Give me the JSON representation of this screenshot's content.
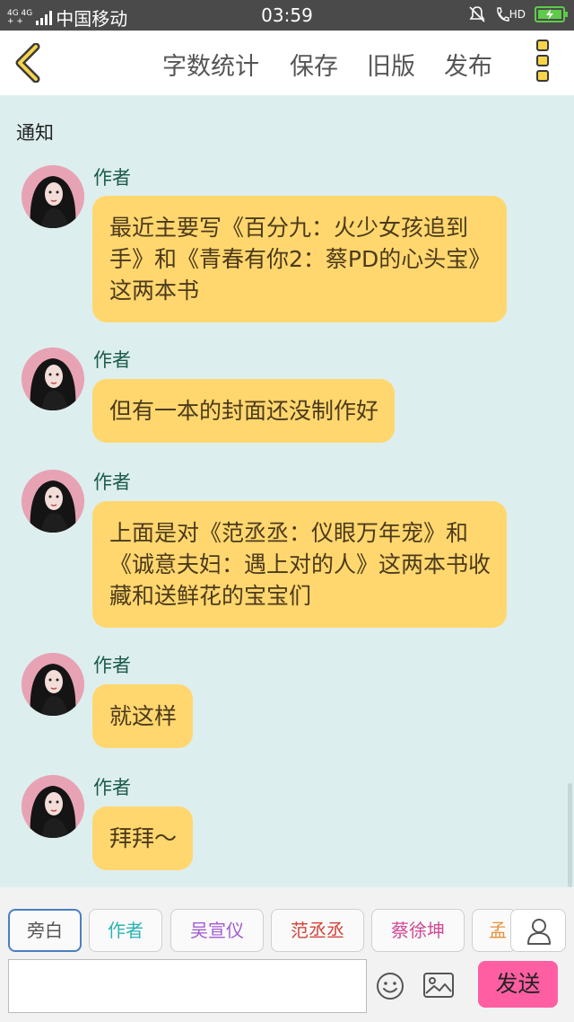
{
  "status": {
    "net_top": "4G 4G",
    "net_bottom": "+ +",
    "carrier": "中国移动",
    "time": "03:59",
    "hd": "HD"
  },
  "header": {
    "menu": [
      "字数统计",
      "保存",
      "旧版",
      "发布"
    ]
  },
  "notice": "通知",
  "messages": [
    {
      "author": "作者",
      "text": "最近主要写《百分九：火少女孩追到手》和《青春有你2：蔡PD的心头宝》这两本书"
    },
    {
      "author": "作者",
      "text": "但有一本的封面还没制作好"
    },
    {
      "author": "作者",
      "text": "上面是对《范丞丞：仪眼万年宠》和《诚意夫妇：遇上对的人》这两本书收藏和送鲜花的宝宝们"
    },
    {
      "author": "作者",
      "text": "就这样"
    },
    {
      "author": "作者",
      "text": "拜拜～"
    }
  ],
  "roles": [
    {
      "label": "旁白",
      "color": "#555555"
    },
    {
      "label": "作者",
      "color": "#2bb3b3"
    },
    {
      "label": "吴宣仪",
      "color": "#a35bd0"
    },
    {
      "label": "范丞丞",
      "color": "#d0453a"
    },
    {
      "label": "蔡徐坤",
      "color": "#d04a95"
    },
    {
      "label": "孟",
      "color": "#e8913a"
    }
  ],
  "composer": {
    "input_value": "",
    "send_label": "发送"
  },
  "colors": {
    "bubble": "#ffd76e",
    "background": "#ddeeee",
    "send_button": "#ff5fa2"
  }
}
